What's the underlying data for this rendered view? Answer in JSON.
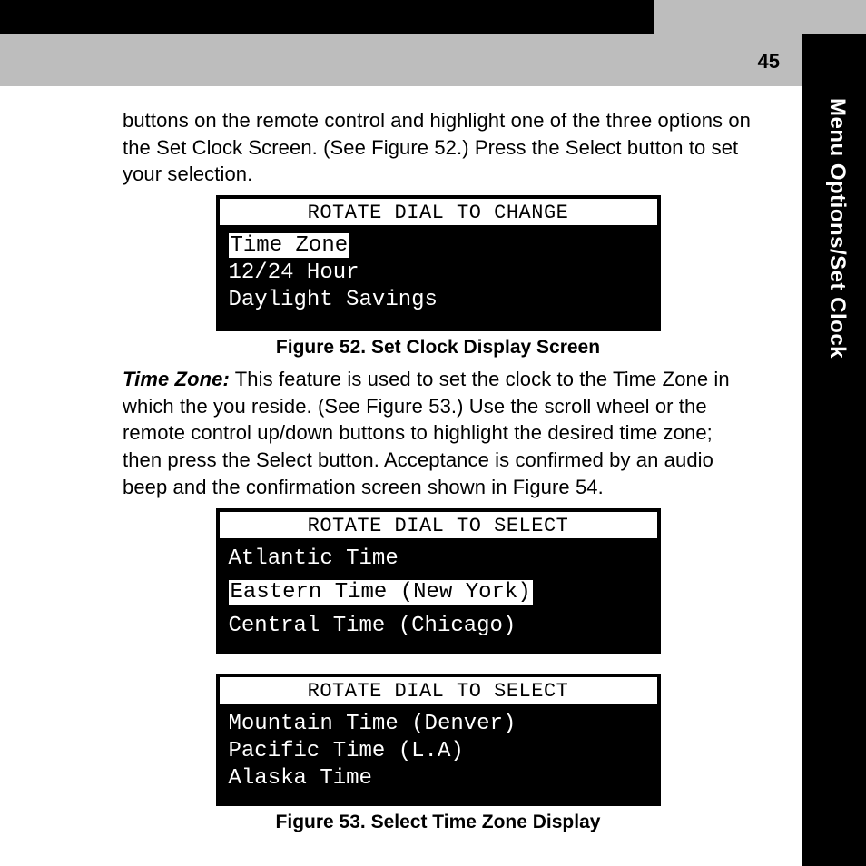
{
  "page_number": "45",
  "section_tab": "Menu Options/Set Clock",
  "intro_para": "buttons on the remote control and highlight one of the three options on the Set Clock Screen. (See Figure 52.)  Press the Select button to set your selection.",
  "fig52": {
    "header": "ROTATE DIAL TO CHANGE",
    "items": [
      "Time Zone",
      "12/24 Hour",
      "Daylight Savings"
    ],
    "selected_index": 0,
    "caption": "Figure 52. Set Clock Display Screen"
  },
  "timezone_para": {
    "lead": "Time Zone:",
    "rest": " This feature is used to set the clock to the Time Zone in which the you reside. (See Figure 53.)  Use the scroll wheel or the remote control up/down buttons to highlight the desired time zone; then  press the Select button.  Acceptance is confirmed by an audio beep and the confirmation screen shown in Figure 54."
  },
  "fig53a": {
    "header": "ROTATE DIAL TO SELECT",
    "items": [
      "Atlantic Time",
      "Eastern Time (New York)",
      "Central Time (Chicago)"
    ],
    "selected_index": 1
  },
  "fig53b": {
    "header": "ROTATE DIAL TO SELECT",
    "items": [
      "Mountain Time (Denver)",
      "Pacific Time (L.A)",
      "Alaska Time"
    ],
    "selected_index": -1
  },
  "fig53_caption": "Figure 53. Select Time Zone Display"
}
